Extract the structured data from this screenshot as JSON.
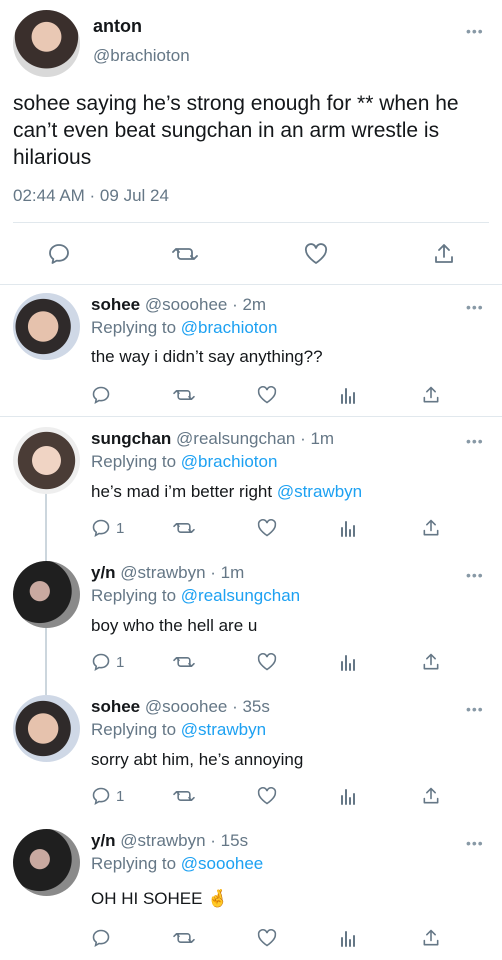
{
  "main_tweet": {
    "name": "anton",
    "handle": "@brachioton",
    "text": "sohee saying he’s strong enough for ** when he can’t even beat sungchan in an arm wrestle is hilarious",
    "timestamp": "02:44 AM · 09 Jul 24",
    "more_label": "•••"
  },
  "replies": [
    {
      "name": "sohee",
      "meta": "@sooohee · 2m",
      "replying_prefix": "Replying to ",
      "replying_to": "@brachioton",
      "text": "the way i didn’t say anything??",
      "mention": "",
      "reply_count": ""
    },
    {
      "name": "sungchan",
      "meta": "@realsungchan · 1m",
      "replying_prefix": "Replying to ",
      "replying_to": "@brachioton",
      "text": "he’s mad i’m better right ",
      "mention": "@strawbyn",
      "reply_count": "1"
    },
    {
      "name": "y/n",
      "meta": "@strawbyn · 1m",
      "replying_prefix": "Replying to ",
      "replying_to": "@realsungchan",
      "text": "boy who the hell are u",
      "mention": "",
      "reply_count": "1"
    },
    {
      "name": "sohee",
      "meta": "@sooohee · 35s",
      "replying_prefix": "Replying to ",
      "replying_to": "@strawbyn",
      "text": "sorry abt him, he’s annoying",
      "mention": "",
      "reply_count": "1"
    },
    {
      "name": "y/n",
      "meta": "@strawbyn · 15s",
      "replying_prefix": "Replying to ",
      "replying_to": "@sooohee",
      "text": "OH HI SOHEE 🤞",
      "mention": "",
      "reply_count": ""
    }
  ],
  "colors": {
    "link": "#1da1f2",
    "muted": "#657786",
    "icon": "#657786",
    "divider": "#e1e8ed",
    "thread_line": "#ccd6dd"
  },
  "icons": {
    "reply": "reply-icon",
    "retweet": "retweet-icon",
    "like": "like-icon",
    "share": "share-icon",
    "analytics": "analytics-icon",
    "more": "more-icon"
  }
}
